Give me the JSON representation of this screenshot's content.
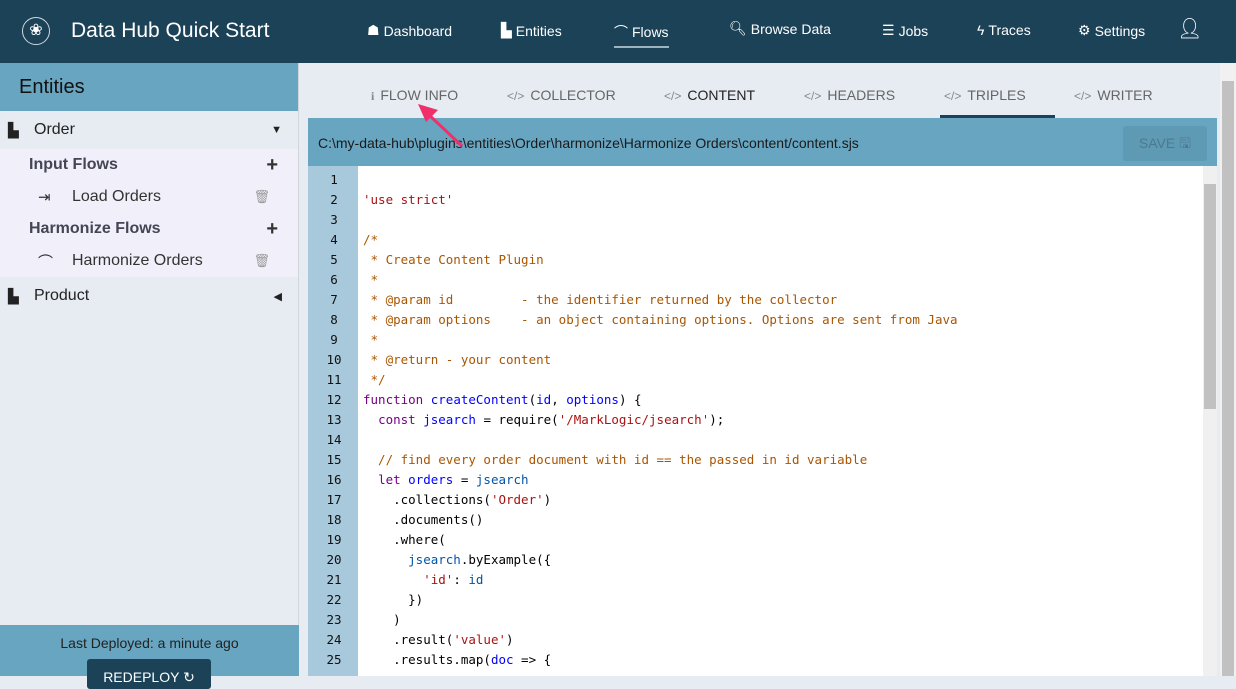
{
  "header": {
    "title": "Data Hub Quick Start",
    "nav": [
      {
        "label": "Dashboard",
        "icon": "dashboard-icon",
        "glyph": "☗"
      },
      {
        "label": "Entities",
        "icon": "factory-icon",
        "glyph": "▙"
      },
      {
        "label": "Flows",
        "icon": "flows-icon",
        "glyph": "⌒"
      },
      {
        "label": "Browse Data",
        "icon": "search-icon",
        "glyph": "🔍︎"
      },
      {
        "label": "Jobs",
        "icon": "jobs-icon",
        "glyph": "☰"
      },
      {
        "label": "Traces",
        "icon": "bolt-icon",
        "glyph": "ϟ"
      },
      {
        "label": "Settings",
        "icon": "gear-icon",
        "glyph": "⚙"
      }
    ],
    "active": "Flows"
  },
  "sidebar": {
    "title": "Entities",
    "entities": [
      {
        "name": "Order",
        "expanded": true,
        "input_flows_label": "Input Flows",
        "input_flows": [
          "Load Orders"
        ],
        "harmonize_flows_label": "Harmonize Flows",
        "harmonize_flows": [
          "Harmonize Orders"
        ]
      },
      {
        "name": "Product",
        "expanded": false
      }
    ],
    "last_deployed": "Last Deployed: a minute ago",
    "redeploy_label": "REDEPLOY"
  },
  "tabs": [
    {
      "label": "FLOW INFO",
      "icon": "info-icon"
    },
    {
      "label": "COLLECTOR",
      "icon": "code-icon"
    },
    {
      "label": "CONTENT",
      "icon": "code-icon",
      "active": true
    },
    {
      "label": "HEADERS",
      "icon": "code-icon"
    },
    {
      "label": "TRIPLES",
      "icon": "code-icon"
    },
    {
      "label": "WRITER",
      "icon": "code-icon"
    }
  ],
  "editor": {
    "path": "C:\\my-data-hub\\plugins\\entities\\Order\\harmonize\\Harmonize Orders\\content/content.sjs",
    "save_label": "SAVE",
    "lines": [
      [],
      [
        [
          "str",
          "'use strict'"
        ]
      ],
      [],
      [
        [
          "com",
          "/*"
        ]
      ],
      [
        [
          "com",
          " * Create Content Plugin"
        ]
      ],
      [
        [
          "com",
          " *"
        ]
      ],
      [
        [
          "com",
          " * @param id         - the identifier returned by the collector"
        ]
      ],
      [
        [
          "com",
          " * @param options    - an object containing options. Options are sent from Java"
        ]
      ],
      [
        [
          "com",
          " *"
        ]
      ],
      [
        [
          "com",
          " * @return - your content"
        ]
      ],
      [
        [
          "com",
          " */"
        ]
      ],
      [
        [
          "kw",
          "function"
        ],
        [
          "p",
          " "
        ],
        [
          "def",
          "createContent"
        ],
        [
          "p",
          "("
        ],
        [
          "def",
          "id"
        ],
        [
          "p",
          ", "
        ],
        [
          "def",
          "options"
        ],
        [
          "p",
          ") {"
        ]
      ],
      [
        [
          "p",
          "  "
        ],
        [
          "kw",
          "const"
        ],
        [
          "p",
          " "
        ],
        [
          "def",
          "jsearch"
        ],
        [
          "p",
          " = require("
        ],
        [
          "str",
          "'/MarkLogic/jsearch'"
        ],
        [
          "p",
          ");"
        ]
      ],
      [],
      [
        [
          "com",
          "  // find every order document with id == the passed in id variable"
        ]
      ],
      [
        [
          "p",
          "  "
        ],
        [
          "kw",
          "let"
        ],
        [
          "p",
          " "
        ],
        [
          "def",
          "orders"
        ],
        [
          "p",
          " = "
        ],
        [
          "var",
          "jsearch"
        ]
      ],
      [
        [
          "p",
          "    .collections("
        ],
        [
          "str",
          "'Order'"
        ],
        [
          "p",
          ")"
        ]
      ],
      [
        [
          "p",
          "    .documents()"
        ]
      ],
      [
        [
          "p",
          "    .where("
        ]
      ],
      [
        [
          "p",
          "      "
        ],
        [
          "var",
          "jsearch"
        ],
        [
          "p",
          ".byExample({"
        ]
      ],
      [
        [
          "p",
          "        "
        ],
        [
          "str",
          "'id'"
        ],
        [
          "p",
          ": "
        ],
        [
          "var",
          "id"
        ]
      ],
      [
        [
          "p",
          "      })"
        ]
      ],
      [
        [
          "p",
          "    )"
        ]
      ],
      [
        [
          "p",
          "    .result("
        ],
        [
          "str",
          "'value'"
        ],
        [
          "p",
          ")"
        ]
      ],
      [
        [
          "p",
          "    .results.map("
        ],
        [
          "def",
          "doc"
        ],
        [
          "p",
          " => {"
        ]
      ]
    ]
  }
}
